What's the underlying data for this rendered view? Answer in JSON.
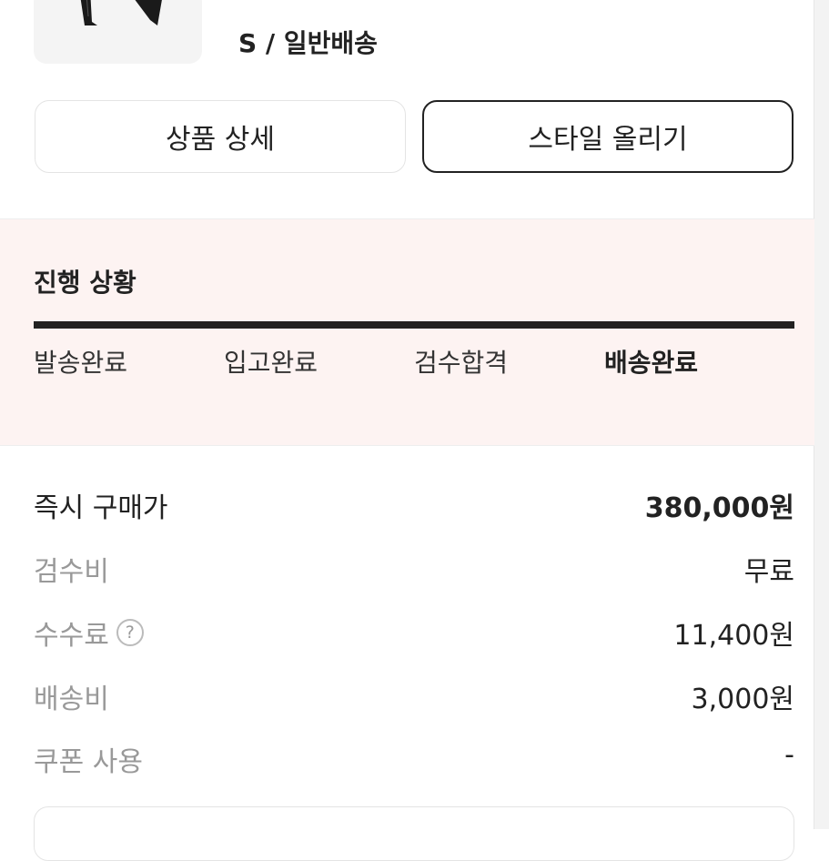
{
  "product": {
    "option": "S / 일반배송"
  },
  "buttons": {
    "detail_label": "상품 상세",
    "style_label": "스타일 올리기"
  },
  "progress": {
    "title": "진행 상황",
    "completed_fraction": 1.0,
    "steps": [
      "발송완료",
      "입고완료",
      "검수합격",
      "배송완료"
    ],
    "active_step": "배송완료"
  },
  "prices": [
    {
      "label": "즉시 구매가",
      "value": "380,000원"
    },
    {
      "label": "검수비",
      "value": "무료"
    },
    {
      "label": "수수료",
      "value": "11,400원",
      "help_icon": "question-circle-icon"
    },
    {
      "label": "배송비",
      "value": "3,000원"
    },
    {
      "label": "쿠폰 사용",
      "value": "-"
    }
  ],
  "colors": {
    "progress_bg": "#fdf3f2",
    "accent_dark": "#222222",
    "muted_text": "#999999"
  }
}
